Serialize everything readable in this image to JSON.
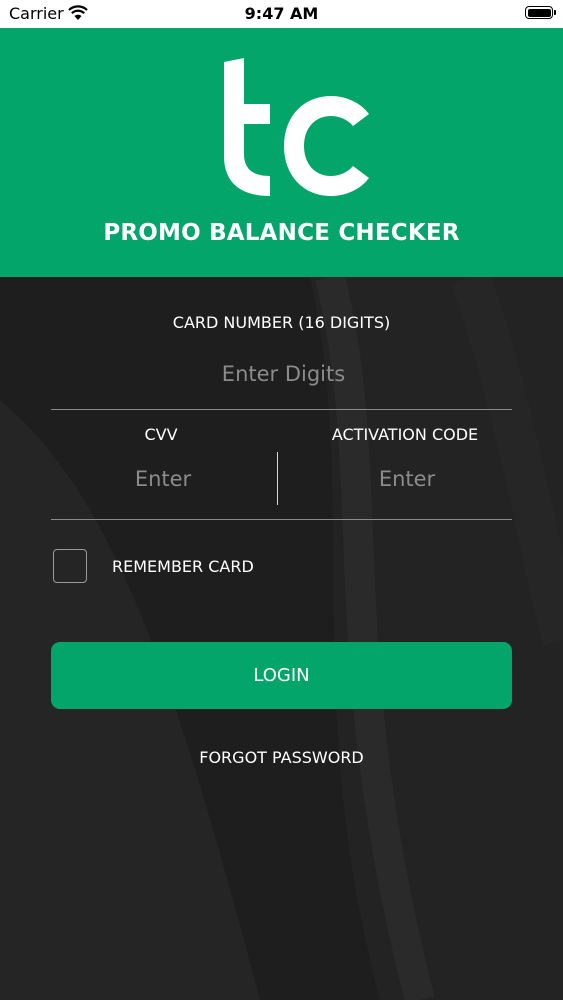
{
  "status_bar": {
    "carrier": "Carrier",
    "time": "9:47 AM"
  },
  "header": {
    "logo_text": "tc",
    "title": "PROMO BALANCE CHECKER",
    "background_color": "#03a56a"
  },
  "form": {
    "card_number_label": "CARD NUMBER (16 DIGITS)",
    "card_number_placeholder": "Enter Digits",
    "card_number_value": "",
    "cvv_label": "CVV",
    "cvv_placeholder": "Enter",
    "cvv_value": "",
    "activation_label": "ACTIVATION CODE",
    "activation_placeholder": "Enter",
    "activation_value": "",
    "remember_label": "REMEMBER CARD",
    "remember_checked": false
  },
  "actions": {
    "login_label": "LOGIN",
    "forgot_label": "FORGOT PASSWORD"
  },
  "colors": {
    "accent": "#03a56a",
    "background": "#1e1e1f"
  }
}
